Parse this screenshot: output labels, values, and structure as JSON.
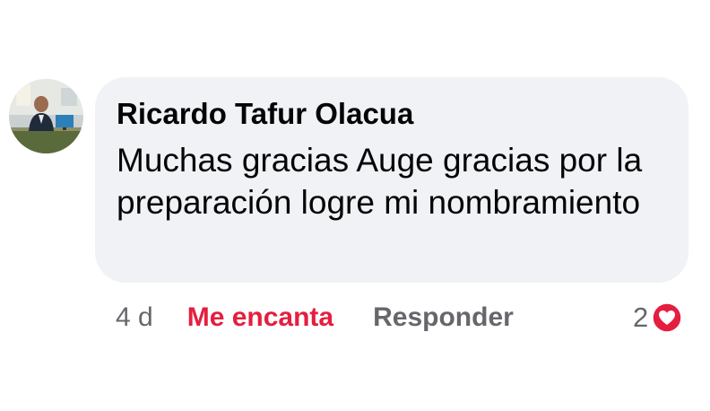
{
  "comment": {
    "author": "Ricardo Tafur Olacua",
    "text": "Muchas gracias Auge gracias por la preparación logre mi nombramiento",
    "time": "4 d",
    "reaction_label": "Me encanta",
    "reply_label": "Responder",
    "reaction_count": "2",
    "reaction_icon": "heart-icon",
    "reaction_color": "#e41e3f"
  }
}
